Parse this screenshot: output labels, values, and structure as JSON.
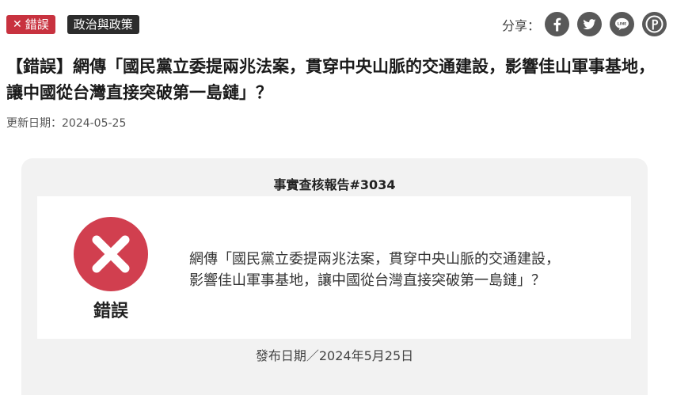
{
  "tags": {
    "verdict_x": "✕",
    "verdict": "錯誤",
    "category": "政治與政策"
  },
  "share": {
    "label": "分享：",
    "items": [
      {
        "name": "facebook",
        "glyph": "f"
      },
      {
        "name": "twitter",
        "glyph": "twitter-bird"
      },
      {
        "name": "line",
        "glyph": "LINE"
      },
      {
        "name": "plurk",
        "glyph": "P"
      }
    ]
  },
  "article": {
    "title": "【錯誤】網傳「國民黨立委提兩兆法案，貫穿中央山脈的交通建設，影響佳山軍事基地，讓中國從台灣直接突破第一島鏈」？",
    "updated": "更新日期：2024-05-25"
  },
  "report": {
    "number": "事實查核報告#3034",
    "verdict_label": "錯誤",
    "claim_line1": "網傳「國民黨立委提兩兆法案，貫穿中央山脈的交通建設，",
    "claim_line2": "影響佳山軍事基地，讓中國從台灣直接突破第一島鏈」？",
    "published": "發布日期／2024年5月25日"
  },
  "colors": {
    "verdict_red": "#c8323f",
    "icon_red": "#d13f4f",
    "category_dark": "#2c2c2c",
    "share_gray": "#595959",
    "card_bg": "#f2f2f2"
  }
}
